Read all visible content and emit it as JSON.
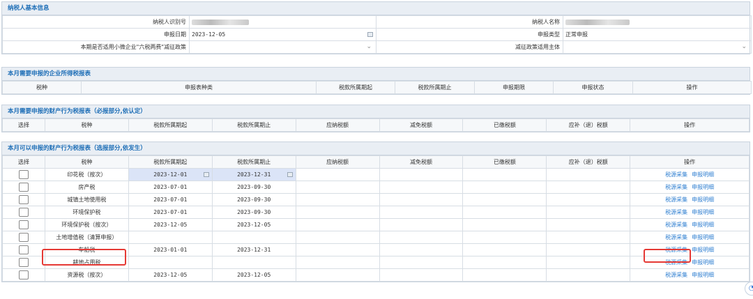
{
  "basic_info": {
    "title": "纳税人基本信息",
    "taxpayer_id_label": "纳税人识别号",
    "taxpayer_name_label": "纳税人名称",
    "declare_date_label": "申报日期",
    "declare_date_value": "2023-12-05",
    "declare_type_label": "申报类型",
    "declare_type_value": "正常申报",
    "policy_label": "本期是否适用小微企业\"六税两费\"减征政策",
    "policy_value": "",
    "policy_subject_label": "减征政策适用主体",
    "policy_subject_value": ""
  },
  "section_cit": {
    "title": "本月需要申报的企业所得税报表",
    "columns": [
      "税种",
      "申报表种类",
      "税款所属期起",
      "税款所属期止",
      "申报期限",
      "申报状态",
      "操作"
    ]
  },
  "section_required": {
    "title": "本月需要申报的财产行为税报表（必报部分,依认定）",
    "columns": [
      "选择",
      "税种",
      "税款所属期起",
      "税款所属期止",
      "应纳税额",
      "减免税额",
      "已缴税额",
      "应补（退）税额",
      "操作"
    ]
  },
  "section_optional": {
    "title": "本月可以申报的财产行为税报表（选报部分,依发生）",
    "columns": [
      "选择",
      "税种",
      "税款所属期起",
      "税款所属期止",
      "应纳税额",
      "减免税额",
      "已缴税额",
      "应补（退）税额",
      "操作"
    ],
    "action_collect": "税源采集",
    "action_detail": "申报明细",
    "rows": [
      {
        "tax": "印花税（按次）",
        "start": "2023-12-01",
        "end": "2023-12-31"
      },
      {
        "tax": "房产税",
        "start": "2023-07-01",
        "end": "2023-09-30"
      },
      {
        "tax": "城镇土地使用税",
        "start": "2023-07-01",
        "end": "2023-09-30"
      },
      {
        "tax": "环境保护税",
        "start": "2023-07-01",
        "end": "2023-09-30"
      },
      {
        "tax": "环境保护税（按次）",
        "start": "2023-12-05",
        "end": "2023-12-05"
      },
      {
        "tax": "土地增值税（清算申报）",
        "start": "",
        "end": ""
      },
      {
        "tax": "车船税",
        "start": "2023-01-01",
        "end": "2023-12-31"
      },
      {
        "tax": "耕地占用税",
        "start": "",
        "end": ""
      },
      {
        "tax": "资源税（按次）",
        "start": "2023-12-05",
        "end": "2023-12-05"
      }
    ]
  },
  "colors": {
    "header_text": "#1f6fb7",
    "link": "#2f7fd1",
    "highlight": "#e53935",
    "date_bg": "#dbe4f7"
  }
}
